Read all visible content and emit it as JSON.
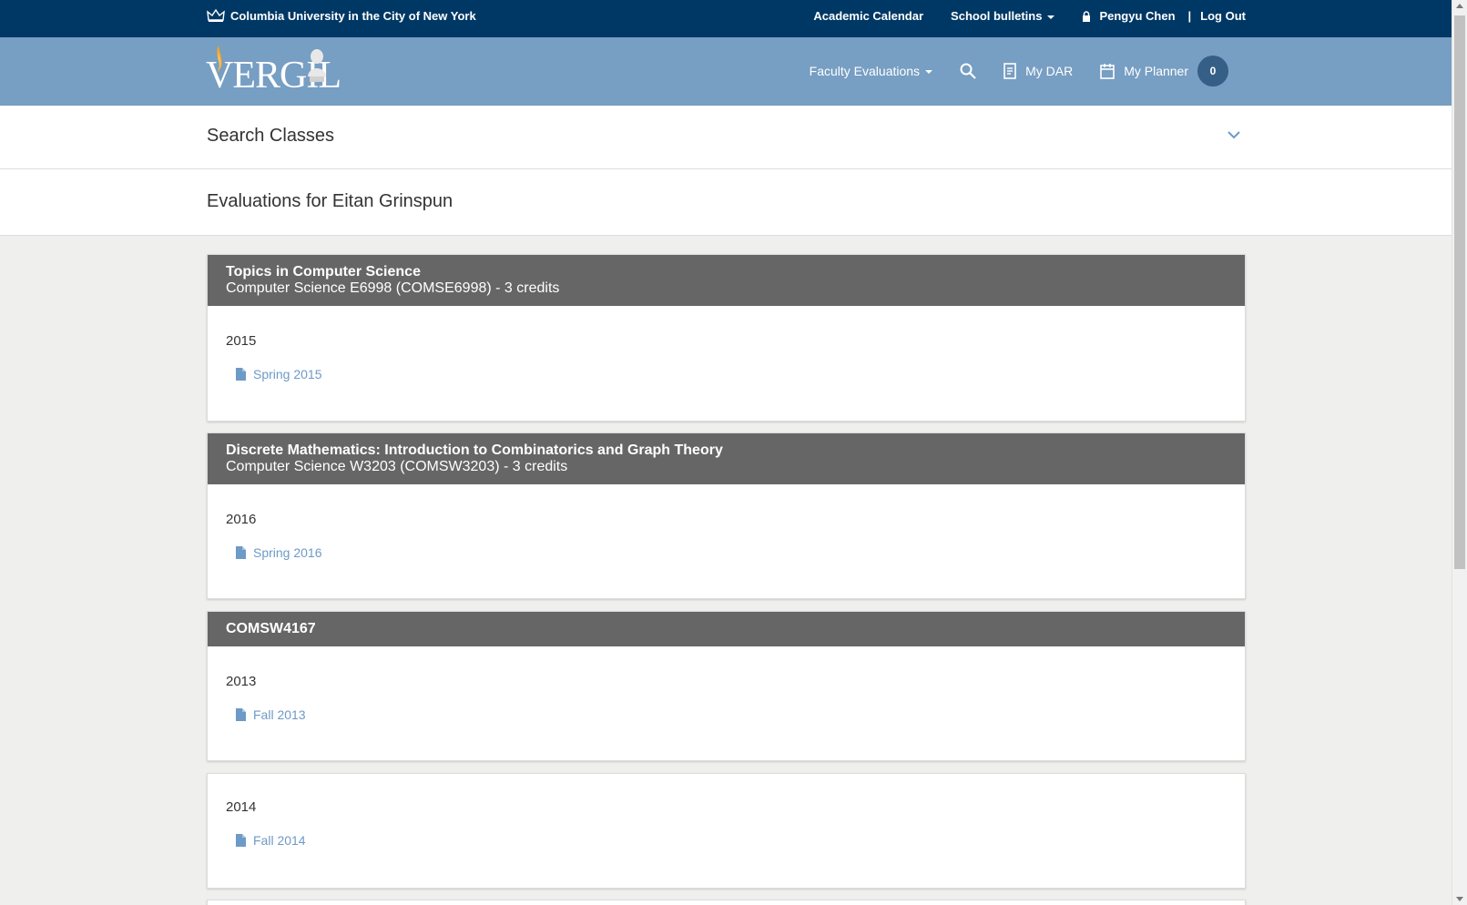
{
  "topbar": {
    "university": "Columbia University in the City of New York",
    "academic_calendar": "Academic Calendar",
    "school_bulletins": "School bulletins",
    "user_name": "Pengyu Chen",
    "separator": "|",
    "logout": "Log Out"
  },
  "header": {
    "logo_text": "VERGIL",
    "faculty_evaluations": "Faculty Evaluations",
    "my_dar": "My DAR",
    "my_planner": "My Planner",
    "planner_count": "0"
  },
  "search": {
    "label": "Search Classes"
  },
  "evaluations": {
    "title": "Evaluations for Eitan Grinspun"
  },
  "cards": [
    {
      "title": "Topics in Computer Science",
      "subtitle": "Computer Science E6998 (COMSE6998) - 3 credits",
      "year": "2015",
      "term": "Spring 2015"
    },
    {
      "title": "Discrete Mathematics: Introduction to Combinatorics and Graph Theory",
      "subtitle": "Computer Science W3203 (COMSW3203) - 3 credits",
      "year": "2016",
      "term": "Spring 2016"
    },
    {
      "title": "COMSW4167",
      "year": "2013",
      "term": "Fall 2013"
    },
    {
      "year": "2014",
      "term": "Fall 2014"
    }
  ],
  "colors": {
    "topbar": "#003865",
    "header": "#779ec3",
    "card_header": "#666666",
    "link": "#6d9ac7"
  }
}
